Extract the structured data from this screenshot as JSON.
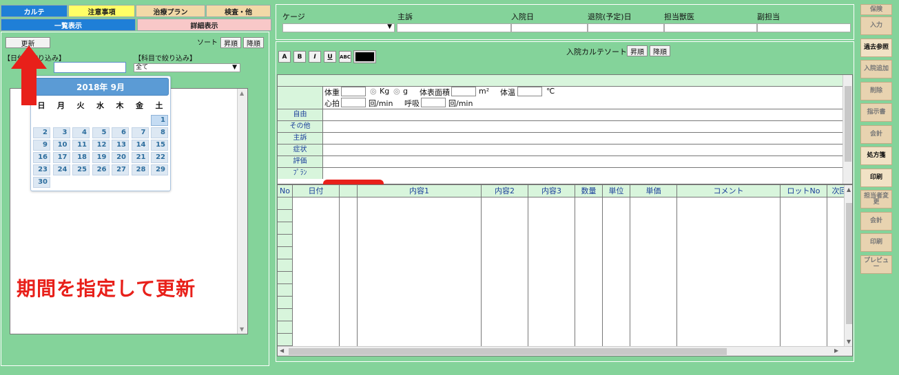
{
  "left": {
    "tabs_top": [
      {
        "label": "カルテ",
        "bg": "#1f7fd7",
        "color": "#ffffff"
      },
      {
        "label": "注意事項",
        "bg": "#ffff66",
        "color": "#222222"
      },
      {
        "label": "治療プラン",
        "bg": "#f2d9a7",
        "color": "#222222"
      },
      {
        "label": "検査・他",
        "bg": "#f2d9a7",
        "color": "#222222"
      }
    ],
    "tabs_second": [
      {
        "label": "一覧表示",
        "bg": "#1f7fd7",
        "color": "#ffffff"
      },
      {
        "label": "詳細表示",
        "bg": "#f8c8c8",
        "color": "#222222"
      }
    ],
    "update_button": "更新",
    "sort_label": "ソート",
    "sort_asc": "昇順",
    "sort_desc": "降順",
    "date_filter_label": "【日付で絞り込み】",
    "subject_filter_label": "【科目で絞り込み】",
    "subject_value": "全て",
    "annotation": "期間を指定して更新"
  },
  "calendar": {
    "title": "2018年 9月",
    "weekdays": [
      "日",
      "月",
      "火",
      "水",
      "木",
      "金",
      "土"
    ],
    "weeks": [
      [
        "",
        "",
        "",
        "",
        "",
        "",
        "1"
      ],
      [
        "2",
        "3",
        "4",
        "5",
        "6",
        "7",
        "8"
      ],
      [
        "9",
        "10",
        "11",
        "12",
        "13",
        "14",
        "15"
      ],
      [
        "16",
        "17",
        "18",
        "19",
        "20",
        "21",
        "22"
      ],
      [
        "23",
        "24",
        "25",
        "26",
        "27",
        "28",
        "29"
      ],
      [
        "30",
        "",
        "",
        "",
        "",
        "",
        ""
      ]
    ],
    "selected": "1"
  },
  "header": {
    "cage_label": "ケージ",
    "complaint_label": "主訴",
    "admission_label": "入院日",
    "discharge_label": "退院(予定)日",
    "doctor_label": "担当獣医",
    "sub_label": "副担当"
  },
  "chart_sort": {
    "label": "入院カルテソート",
    "asc": "昇順",
    "desc": "降順"
  },
  "toolbar": [
    "A",
    "B",
    "I",
    "U",
    "ABC"
  ],
  "vitals": {
    "weight": "体重",
    "kg": "Kg",
    "g": "g",
    "bsa": "体表面積",
    "m2": "m²",
    "temp": "体温",
    "celsius": "℃",
    "hr": "心拍",
    "per_min": "回/min",
    "resp": "呼吸",
    "per_min2": "回/min",
    "rows": [
      "自由",
      "その他",
      "主訴",
      "症状",
      "評価",
      "ﾌﾟﾗﾝ"
    ]
  },
  "grid": {
    "columns": [
      "No",
      "日付",
      "",
      "内容1",
      "内容2",
      "内容3",
      "数量",
      "単位",
      "単価",
      "コメント",
      "ロットNo",
      "次回"
    ]
  },
  "side_buttons": [
    {
      "label": "保険",
      "active": false
    },
    {
      "label": "入力",
      "active": false
    },
    {
      "label": "過去参照",
      "active": true
    },
    {
      "label": "入院追加",
      "active": false
    },
    {
      "label": "削除",
      "active": false
    },
    {
      "label": "指示書",
      "active": false
    },
    {
      "label": "会計",
      "active": false
    },
    {
      "label": "処方箋",
      "active": true
    },
    {
      "label": "印刷",
      "active": true
    },
    {
      "label": "担当者変更",
      "active": false
    },
    {
      "label": "会計",
      "active": false
    },
    {
      "label": "印刷",
      "active": false
    },
    {
      "label": "プレビュー",
      "active": false
    }
  ]
}
